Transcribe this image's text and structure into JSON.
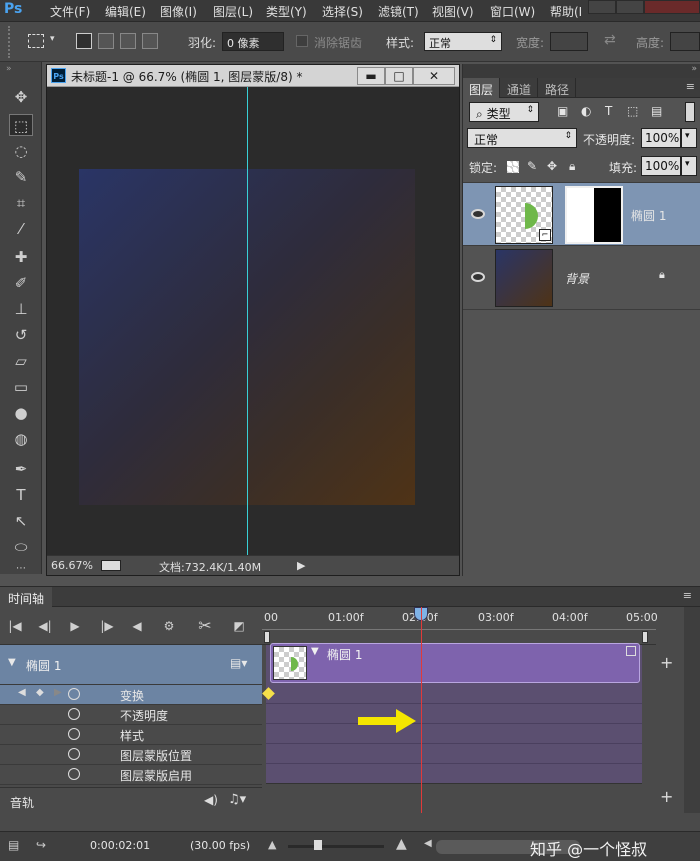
{
  "app": {
    "logo": "Ps"
  },
  "menu": [
    "文件(F)",
    "编辑(E)",
    "图像(I)",
    "图层(L)",
    "类型(Y)",
    "选择(S)",
    "滤镜(T)",
    "视图(V)",
    "窗口(W)",
    "帮助(I"
  ],
  "options": {
    "feather_label": "羽化:",
    "feather_value": "0 像素",
    "antialias_label": "消除锯齿",
    "style_label": "样式:",
    "style_value": "正常",
    "width_label": "宽度:",
    "height_label": "高度:"
  },
  "document": {
    "title": "未标题-1 @ 66.7% (椭圆 1, 图层蒙版/8) *",
    "zoom": "66.67%",
    "doc_info": "文档:732.4K/1.40M",
    "minimize": "▬",
    "maximize": "□",
    "close": "✕"
  },
  "layers_panel": {
    "tabs": [
      "图层",
      "通道",
      "路径"
    ],
    "filter_label": "类型",
    "blend_mode": "正常",
    "opacity_label": "不透明度:",
    "opacity_value": "100%",
    "lock_label": "锁定:",
    "fill_label": "填充:",
    "fill_value": "100%",
    "layers": [
      {
        "name": "椭圆 1"
      },
      {
        "name": "背景"
      }
    ]
  },
  "timeline": {
    "tab": "时间轴",
    "ruler": [
      "00",
      "01:00f",
      "02:00f",
      "03:00f",
      "04:00f",
      "05:00"
    ],
    "layer_name": "椭圆 1",
    "clip_name": "椭圆 1",
    "properties": [
      "变换",
      "不透明度",
      "样式",
      "图层蒙版位置",
      "图层蒙版启用"
    ],
    "audio_label": "音轨",
    "current_time": "0:00:02:01",
    "fps": "(30.00 fps)"
  },
  "watermark": "知乎 @一个怪叔",
  "colors": {
    "accent": "#4aa3f0",
    "clip": "#7e63ad",
    "playhead": "#e03a3a",
    "guide": "#38d0d6",
    "arrow": "#f5e600",
    "selected_layer": "#7e95b3"
  }
}
